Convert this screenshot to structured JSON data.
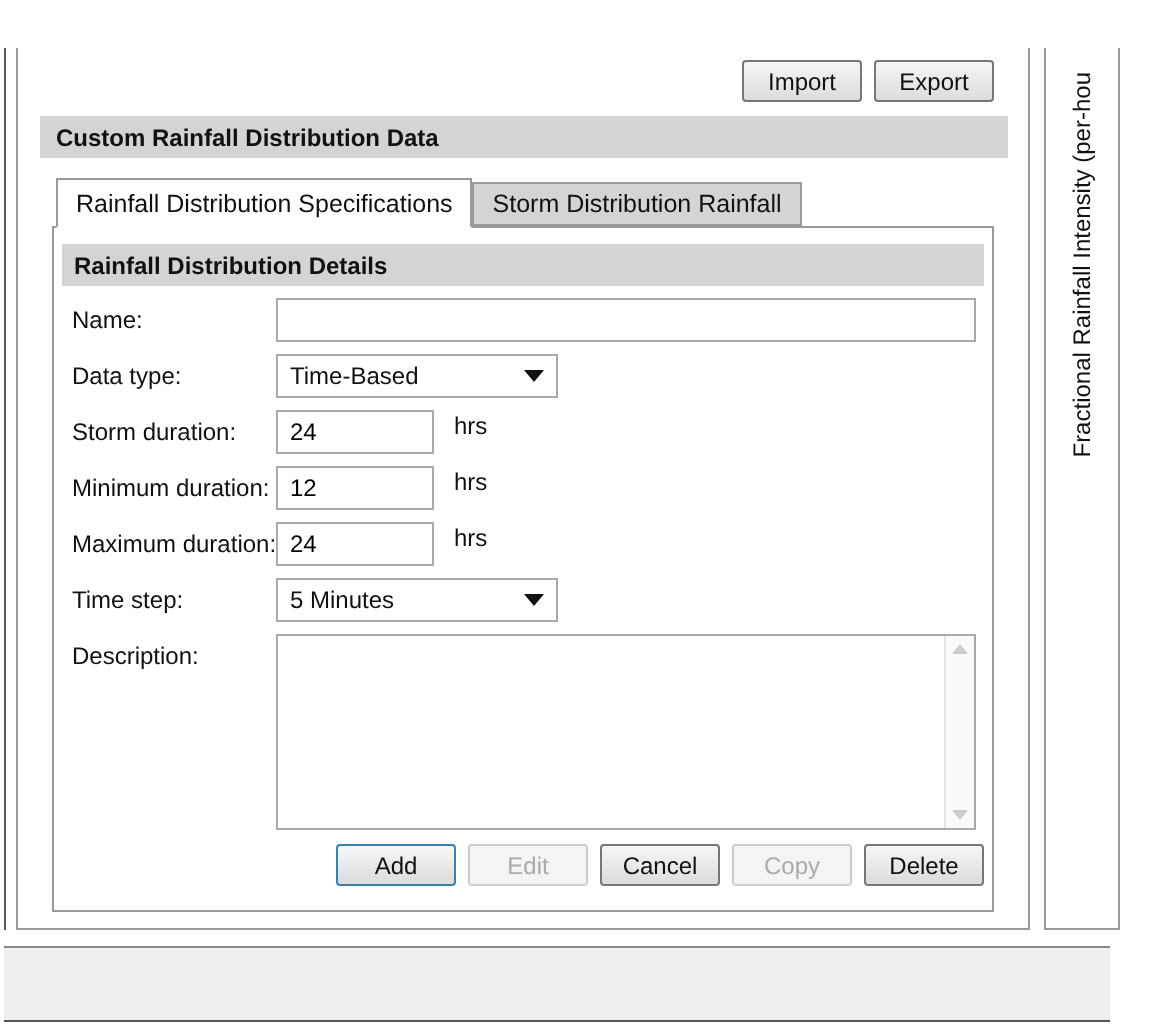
{
  "top_buttons": [
    {
      "label": "Import"
    },
    {
      "label": "Export"
    }
  ],
  "section_title": "Custom Rainfall Distribution Data",
  "tabs": [
    {
      "label": "Rainfall Distribution Specifications",
      "selected": true
    },
    {
      "label": "Storm Distribution Rainfall",
      "selected": false
    }
  ],
  "group_title": "Rainfall Distribution Details",
  "fields": [
    {
      "kind": "text",
      "label": "Name:",
      "wide": true
    },
    {
      "kind": "dropdown",
      "label": "Data type:",
      "value": "Time-Based"
    },
    {
      "kind": "text",
      "label": "Storm duration:",
      "value": "24",
      "unit": "hrs"
    },
    {
      "kind": "text",
      "label": "Minimum duration:",
      "value": "12",
      "unit": "hrs"
    },
    {
      "kind": "text",
      "label": "Maximum duration:",
      "value": "24",
      "unit": "hrs"
    },
    {
      "kind": "dropdown",
      "label": "Time step:",
      "value": "5 Minutes"
    },
    {
      "kind": "textarea",
      "label": "Description:"
    }
  ],
  "buttons": [
    {
      "label": "Add",
      "disabled": false,
      "default": true
    },
    {
      "label": "Edit",
      "disabled": true,
      "default": false
    },
    {
      "label": "Cancel",
      "disabled": false,
      "default": false
    },
    {
      "label": "Copy",
      "disabled": true,
      "default": false
    },
    {
      "label": "Delete",
      "disabled": false,
      "default": false
    }
  ],
  "side_axis_label": "Fractional Rainfall Intensity (per-hou"
}
